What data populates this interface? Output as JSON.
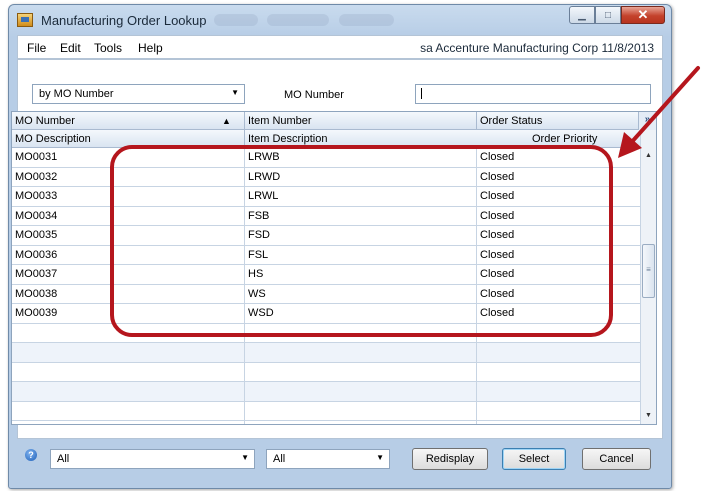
{
  "window": {
    "title": "Manufacturing Order Lookup",
    "controls": [
      "minimize",
      "maximize",
      "close"
    ]
  },
  "menu": {
    "items": [
      "File",
      "Edit",
      "Tools",
      "Help"
    ],
    "company_info": "sa  Accenture Manufacturing Corp  11/8/2013"
  },
  "filter": {
    "sort_by_value": "by MO Number",
    "search_label": "MO Number",
    "search_value": ""
  },
  "grid": {
    "headers_row1": [
      "MO Number",
      "Item Number",
      "Order Status"
    ],
    "headers_row2": [
      "MO Description",
      "Item Description",
      "Order Priority"
    ],
    "rows": [
      {
        "mo": "MO0031",
        "item": "LRWB",
        "status": "Closed"
      },
      {
        "mo": "MO0032",
        "item": "LRWD",
        "status": "Closed"
      },
      {
        "mo": "MO0033",
        "item": "LRWL",
        "status": "Closed"
      },
      {
        "mo": "MO0034",
        "item": "FSB",
        "status": "Closed"
      },
      {
        "mo": "MO0035",
        "item": "FSD",
        "status": "Closed"
      },
      {
        "mo": "MO0036",
        "item": "FSL",
        "status": "Closed"
      },
      {
        "mo": "MO0037",
        "item": "HS",
        "status": "Closed"
      },
      {
        "mo": "MO0038",
        "item": "WS",
        "status": "Closed"
      },
      {
        "mo": "MO0039",
        "item": "WSD",
        "status": "Closed"
      }
    ],
    "empty_rows": 5
  },
  "footer": {
    "filter1_value": "All",
    "filter2_value": "All",
    "redisplay_label": "Redisplay",
    "select_label": "Select",
    "cancel_label": "Cancel"
  },
  "annotation": {
    "color": "#b5161d"
  }
}
